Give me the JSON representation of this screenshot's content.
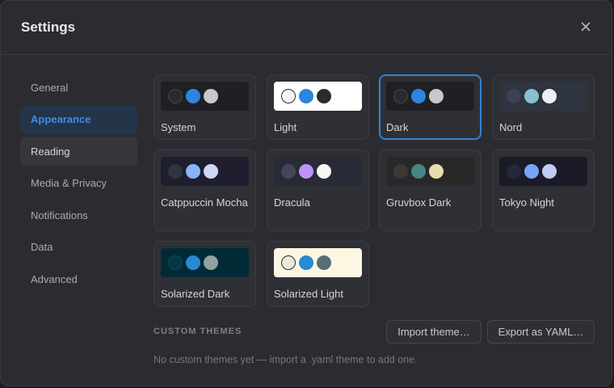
{
  "dialog": {
    "title": "Settings",
    "close_icon": "close-icon"
  },
  "sidebar": {
    "items": [
      {
        "label": "General",
        "state": "normal"
      },
      {
        "label": "Appearance",
        "state": "active"
      },
      {
        "label": "Reading",
        "state": "hover"
      },
      {
        "label": "Media & Privacy",
        "state": "normal"
      },
      {
        "label": "Notifications",
        "state": "normal"
      },
      {
        "label": "Data",
        "state": "normal"
      },
      {
        "label": "Advanced",
        "state": "normal"
      }
    ]
  },
  "themes": [
    {
      "name": "System",
      "selected": false,
      "bg": "#1f2024",
      "dots": [
        {
          "fill": "#2a2b30",
          "stroke": "#45464b"
        },
        {
          "fill": "#2b86df",
          "stroke": "#2b86df"
        },
        {
          "fill": "#c7c8cb",
          "stroke": "#c7c8cb"
        }
      ]
    },
    {
      "name": "Light",
      "selected": false,
      "bg": "#ffffff",
      "dots": [
        {
          "fill": "#f4f5f7",
          "stroke": "#2a2b30"
        },
        {
          "fill": "#2b86df",
          "stroke": "#2b86df"
        },
        {
          "fill": "#2a2b30",
          "stroke": "#2a2b30"
        }
      ]
    },
    {
      "name": "Dark",
      "selected": true,
      "bg": "#1f2024",
      "dots": [
        {
          "fill": "#2a2b30",
          "stroke": "#45464b"
        },
        {
          "fill": "#2b86df",
          "stroke": "#2b86df"
        },
        {
          "fill": "#c7c8cb",
          "stroke": "#c7c8cb"
        }
      ]
    },
    {
      "name": "Nord",
      "selected": false,
      "bg": "#2e3440",
      "dots": [
        {
          "fill": "#3b4252",
          "stroke": "#3b4252"
        },
        {
          "fill": "#88c0d0",
          "stroke": "#88c0d0"
        },
        {
          "fill": "#eceff4",
          "stroke": "#eceff4"
        }
      ]
    },
    {
      "name": "Catppuccin Mocha",
      "selected": false,
      "bg": "#1e1e2e",
      "dots": [
        {
          "fill": "#313244",
          "stroke": "#313244"
        },
        {
          "fill": "#89b4fa",
          "stroke": "#89b4fa"
        },
        {
          "fill": "#cdd6f4",
          "stroke": "#cdd6f4"
        }
      ]
    },
    {
      "name": "Dracula",
      "selected": false,
      "bg": "#282a36",
      "dots": [
        {
          "fill": "#44475a",
          "stroke": "#44475a"
        },
        {
          "fill": "#bd93f9",
          "stroke": "#bd93f9"
        },
        {
          "fill": "#f8f8f2",
          "stroke": "#f8f8f2"
        }
      ]
    },
    {
      "name": "Gruvbox Dark",
      "selected": false,
      "bg": "#282828",
      "dots": [
        {
          "fill": "#3c3836",
          "stroke": "#3c3836"
        },
        {
          "fill": "#458588",
          "stroke": "#458588"
        },
        {
          "fill": "#ebdbb2",
          "stroke": "#ebdbb2"
        }
      ]
    },
    {
      "name": "Tokyo Night",
      "selected": false,
      "bg": "#1a1b26",
      "dots": [
        {
          "fill": "#24283b",
          "stroke": "#24283b"
        },
        {
          "fill": "#7aa2f7",
          "stroke": "#7aa2f7"
        },
        {
          "fill": "#c0caf5",
          "stroke": "#c0caf5"
        }
      ]
    },
    {
      "name": "Solarized Dark",
      "selected": false,
      "bg": "#002b36",
      "dots": [
        {
          "fill": "#073642",
          "stroke": "#0d4a57"
        },
        {
          "fill": "#268bd2",
          "stroke": "#268bd2"
        },
        {
          "fill": "#93a1a1",
          "stroke": "#93a1a1"
        }
      ]
    },
    {
      "name": "Solarized Light",
      "selected": false,
      "bg": "#fdf6e3",
      "dots": [
        {
          "fill": "#eee8d5",
          "stroke": "#2a2b30"
        },
        {
          "fill": "#268bd2",
          "stroke": "#268bd2"
        },
        {
          "fill": "#586e75",
          "stroke": "#586e75"
        }
      ]
    }
  ],
  "custom_themes": {
    "heading": "CUSTOM THEMES",
    "import_button": "Import theme…",
    "export_button": "Export as YAML…",
    "empty_message": "No custom themes yet — import a .yaml theme to add one."
  },
  "colors": {
    "accent": "#2f84d6",
    "dialog_bg": "#2b2c31"
  }
}
